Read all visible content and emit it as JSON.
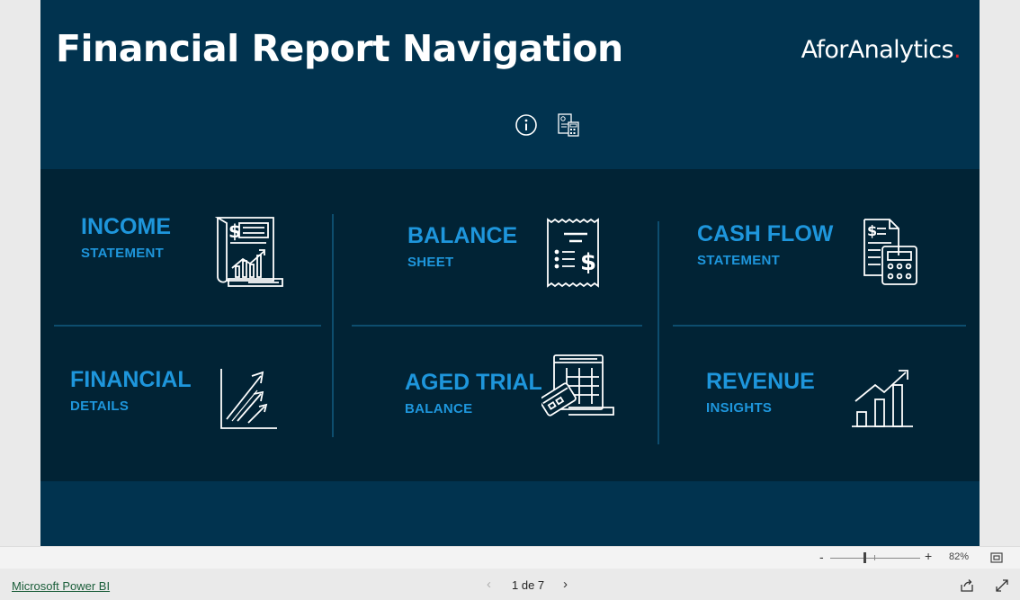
{
  "report": {
    "title": "Financial Report Navigation",
    "brand": "AforAnalytics",
    "brand_dot": ".",
    "brand_dot_color": "#e8202a",
    "background_color": "#01334f",
    "panel_color": "#012335",
    "accent_color": "#1e96dc"
  },
  "header_icons": [
    {
      "name": "info-icon"
    },
    {
      "name": "calculator-document-icon"
    }
  ],
  "nav": {
    "income": {
      "line1": "INCOME",
      "line2": "STATEMENT",
      "icon": "income-statement-icon"
    },
    "balance": {
      "line1": "BALANCE",
      "line2": "SHEET",
      "icon": "receipt-dollar-icon"
    },
    "cashflow": {
      "line1": "CASH FLOW",
      "line2": "STATEMENT",
      "icon": "document-calculator-icon"
    },
    "financial": {
      "line1": "FINANCIAL",
      "line2": "DETAILS",
      "icon": "growth-arrows-icon"
    },
    "aged": {
      "line1": "AGED TRIAL",
      "line2": "BALANCE",
      "icon": "card-ledger-icon"
    },
    "revenue": {
      "line1": "REVENUE",
      "line2": "INSIGHTS",
      "icon": "bar-chart-trend-icon"
    }
  },
  "status": {
    "zoom_minus": "-",
    "zoom_plus": "+",
    "zoom": "82%"
  },
  "footer": {
    "app_link": "Microsoft Power BI",
    "page_indicator": "1 de 7",
    "prev": "‹",
    "next": "›"
  }
}
